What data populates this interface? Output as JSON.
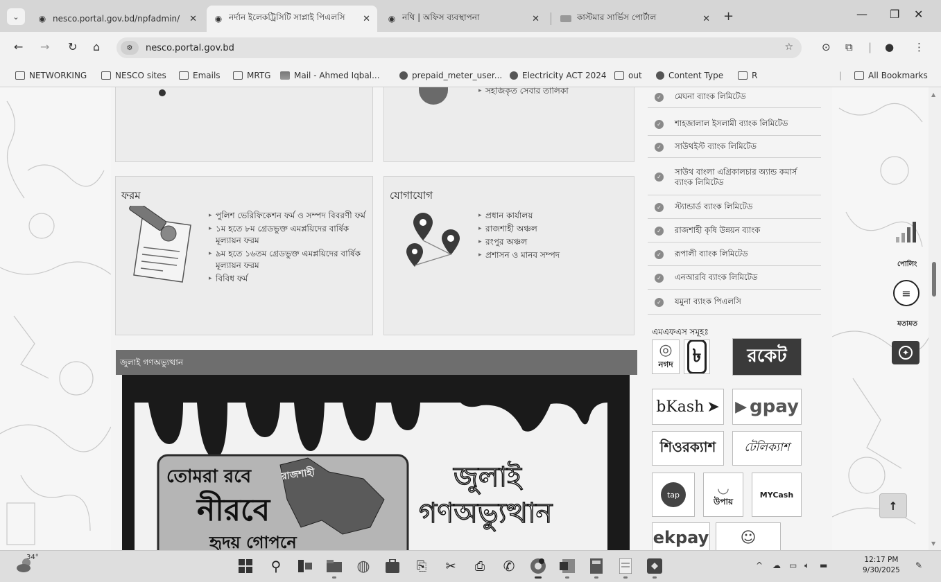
{
  "browser": {
    "tabs": [
      {
        "title": "nesco.portal.gov.bd/npfadmin/",
        "active": false
      },
      {
        "title": "নর্দান ইলেকট্রিসিটি সাপ্লাই পিএলসি",
        "active": true
      },
      {
        "title": "নথি | অফিস ব্যবস্থাপনা",
        "active": false
      },
      {
        "title": "কাস্টমার সার্ভিস পোর্টাল",
        "active": false
      }
    ],
    "url": "nesco.portal.gov.bd",
    "bookmarks": [
      "NETWORKING",
      "NESCO sites",
      "Emails",
      "MRTG",
      "Mail - Ahmed Iqbal...",
      "prepaid_meter_user...",
      "Electricity ACT 2024",
      "out",
      "Content Type",
      "R"
    ],
    "all_bookmarks": "All Bookmarks"
  },
  "top_cards": {
    "right_item": "সহজিকৃত সেবার তালিকা"
  },
  "form_card": {
    "title": "ফরম",
    "items": [
      "পুলিশ ভেরিফিকেশন ফর্ম ও সম্পদ বিবরণী ফর্ম",
      "১ম হতে ৮ম গ্রেডভুক্ত এমপ্লয়িদের বার্ষিক মূল্যায়ন ফরম",
      "৯ম হতে ১৬তম গ্রেডভুক্ত এমপ্লয়িদের বার্ষিক মূল্যায়ন ফরম",
      "বিবিধ ফর্ম"
    ]
  },
  "contact_card": {
    "title": "যোগাযোগ",
    "items": [
      "প্রধান কার্যালয়",
      "রাজশাহী অঞ্চল",
      "রংপুর অঞ্চল",
      "প্রশাসন ও মানব সম্পদ"
    ]
  },
  "section": {
    "title": "জুলাই গণঅভ্যুত্থান",
    "banner_left_top": "তোমরা রবে",
    "banner_left_big": "নীরবে",
    "banner_left_bottom": "হৃদয় গোপনে",
    "banner_region": "রাজশাহী",
    "banner_right_1": "জুলাই",
    "banner_right_2": "গণঅভ্যুত্থান"
  },
  "banks": [
    "মেঘনা ব্যাংক লিমিটেড",
    "শাহজালাল ইসলামী ব্যাংক লিমিটেড",
    "সাউথইস্ট ব্যাংক লিমিটেড",
    "সাউথ বাংলা এগ্রিকালচার অ্যান্ড কমার্স ব্যাংক লিমিটেড",
    "স্ট্যান্ডার্ড ব্যাংক লিমিটেড",
    "রাজশাহী কৃষি উন্নয়ন ব্যাংক",
    "রূপালী ব্যাংক লিমিটেড",
    "এনআরবি ব্যাংক লিমিটেড",
    "যমুনা ব্যাংক পিএলসি"
  ],
  "mfs": {
    "title": "এমএফএস সমূহঃ",
    "logos": [
      "নগদ",
      "৳",
      "রকেট",
      "bKash",
      "gpay",
      "শিওরক্যাশ",
      "টেলিক্যাশ",
      "tap",
      "উপায়",
      "MYCash",
      "ekpay"
    ]
  },
  "widgets": {
    "poll_label": "পোলিং",
    "feedback_label": "মতামত"
  },
  "taskbar": {
    "weather": "34°",
    "time": "12:17 PM",
    "date": "9/30/2025"
  }
}
